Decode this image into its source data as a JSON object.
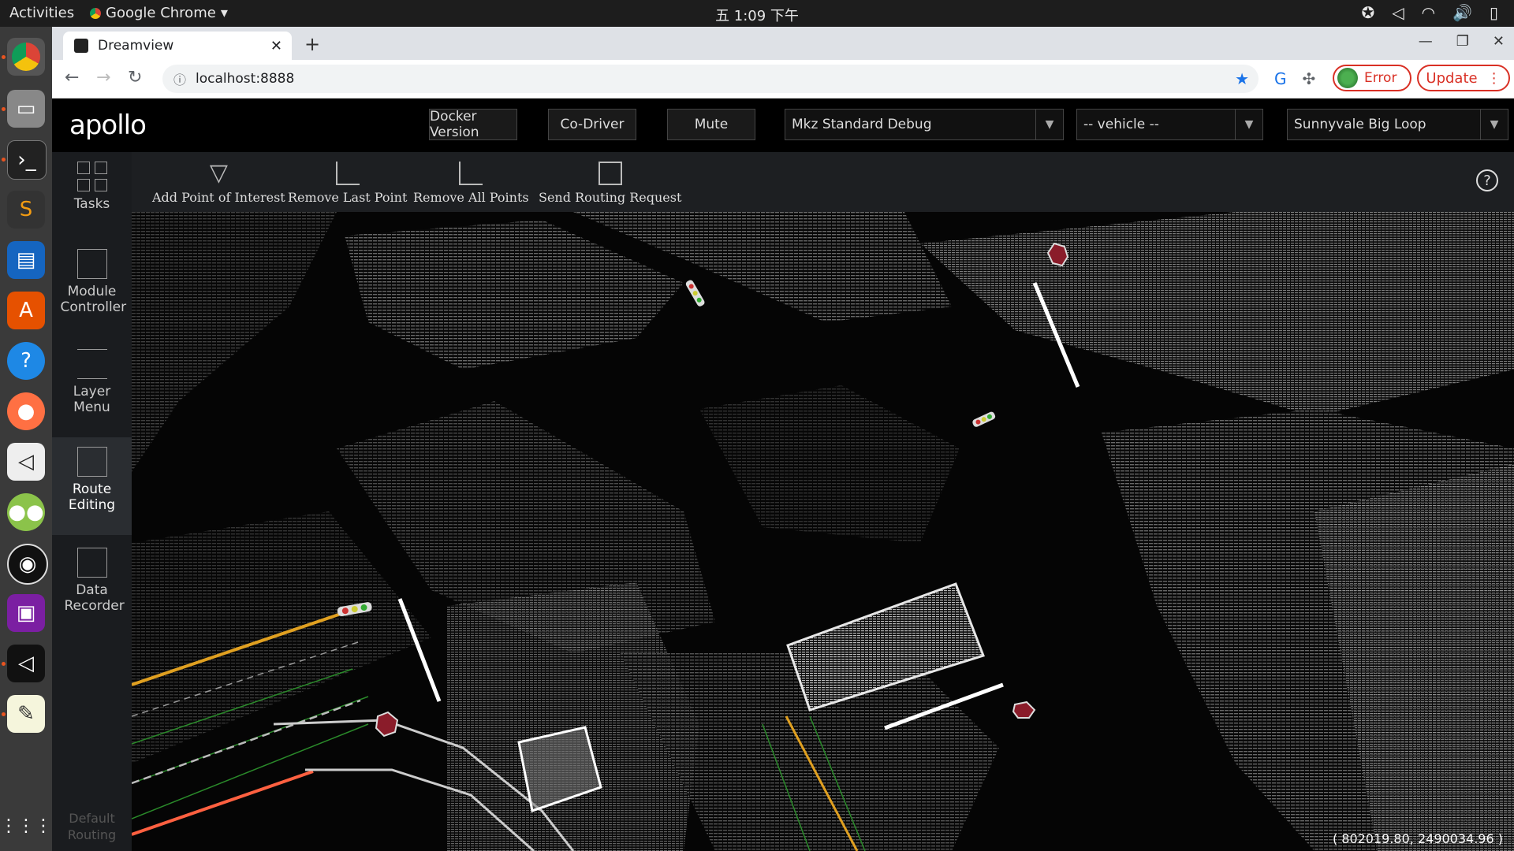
{
  "topbar": {
    "activities": "Activities",
    "app": "Google Chrome",
    "clock": "五 1:09 下午"
  },
  "browser": {
    "tab_title": "Dreamview",
    "url": "localhost:8888",
    "error_label": "Error",
    "update_label": "Update"
  },
  "header": {
    "logo": "apollo",
    "buttons": [
      "Docker Version",
      "Co-Driver",
      "Mute"
    ],
    "mode_select": "Mkz Standard Debug",
    "vehicle_select": "-- vehicle --",
    "map_select": "Sunnyvale Big Loop"
  },
  "sidebar": {
    "items": [
      {
        "label": "Tasks"
      },
      {
        "label": "Module Controller"
      },
      {
        "label": "Layer Menu"
      },
      {
        "label": "Route Editing"
      },
      {
        "label": "Data Recorder"
      }
    ],
    "default_routing": "Default Routing"
  },
  "route_editing": {
    "buttons": [
      "Add Point of Interest",
      "Remove Last Point",
      "Remove All Points",
      "Send Routing Request"
    ]
  },
  "scene": {
    "coordinates": "( 802019.80, 2490034.96 )"
  },
  "colors": {
    "lane_yellow": "#e0a020",
    "lane_red": "#ff6040",
    "lane_green": "#2a8a2a",
    "stop_line": "#ffffff"
  }
}
